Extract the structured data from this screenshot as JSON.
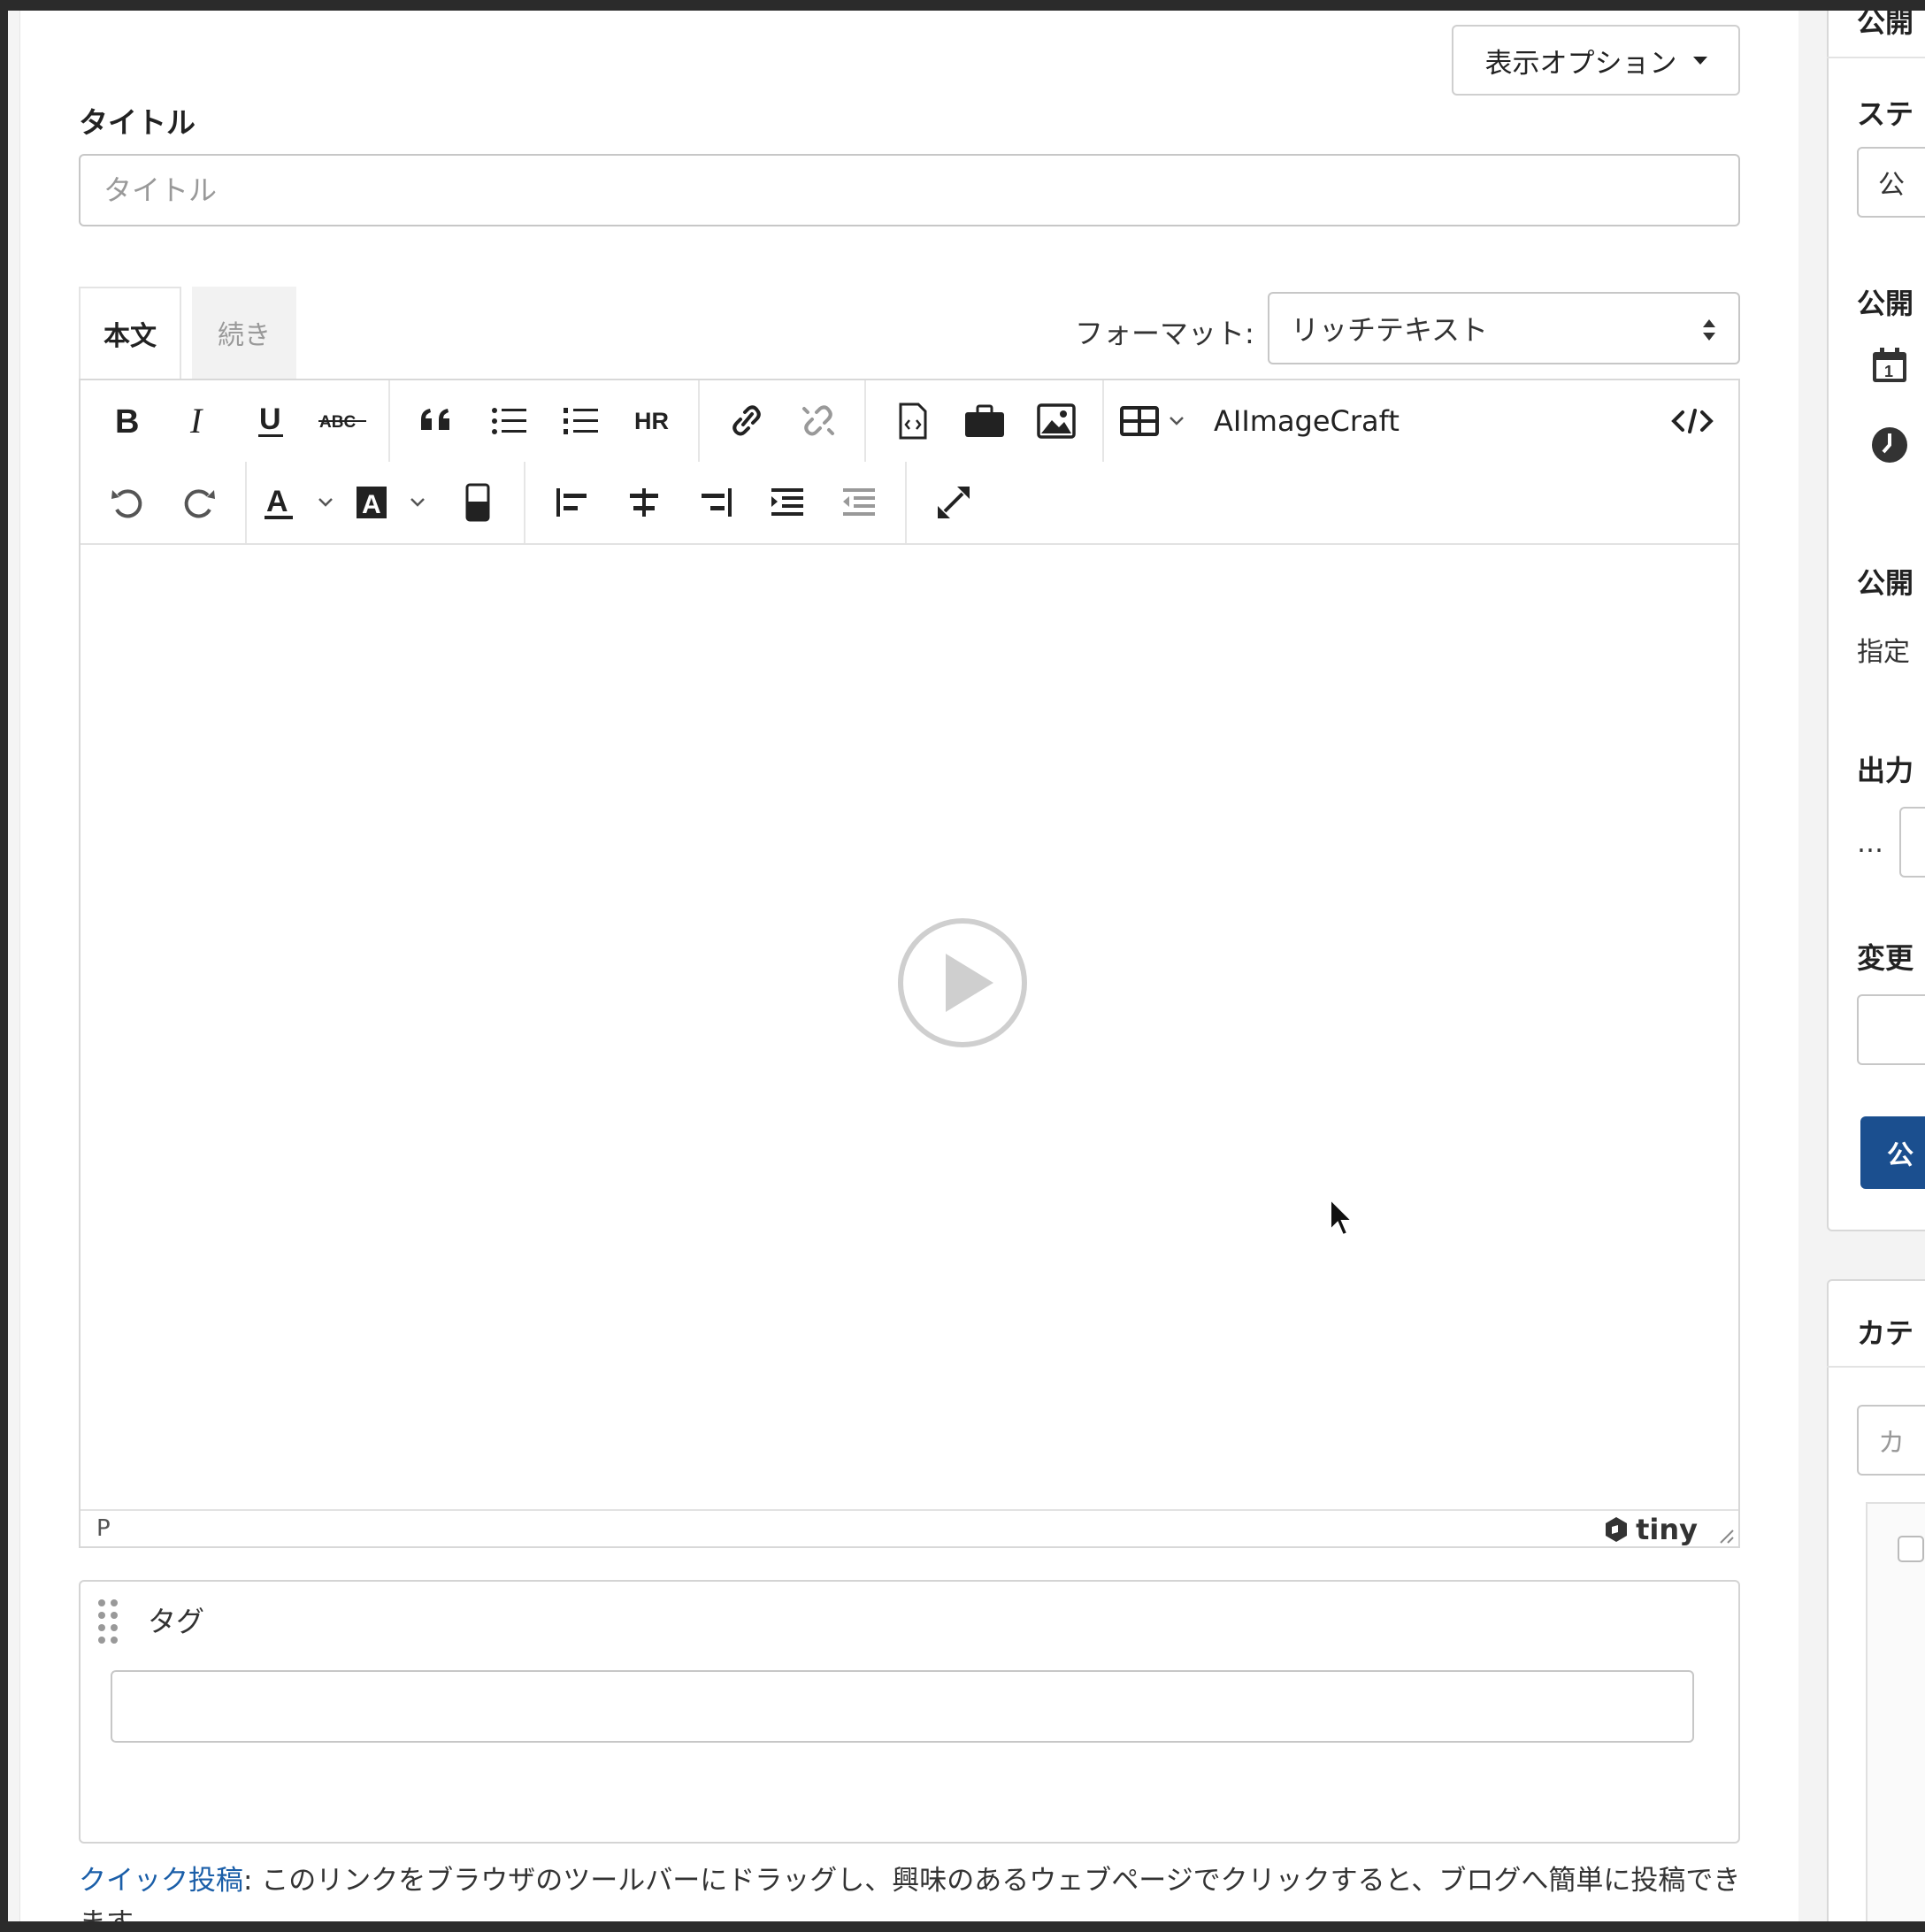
{
  "top": {
    "display_options_label": "表示オプション"
  },
  "title": {
    "label": "タイトル",
    "placeholder": "タイトル",
    "value": ""
  },
  "tabs": [
    {
      "label": "本文",
      "active": true
    },
    {
      "label": "続き",
      "active": false
    }
  ],
  "format": {
    "label": "フォーマット:",
    "value": "リッチテキスト"
  },
  "toolbar": {
    "row1": [
      "bold-icon",
      "italic-icon",
      "underline-icon",
      "strikethrough-icon",
      "blockquote-icon",
      "bullet-list-icon",
      "numbered-list-icon",
      "horizontal-rule-icon",
      "link-icon",
      "unlink-icon",
      "insert-file-icon",
      "asset-icon",
      "image-icon",
      "table-icon",
      "source-code-icon"
    ],
    "hr_label": "HR",
    "abc_label": "ABC",
    "plugin_label": "AIImageCraft",
    "row2": [
      "undo-icon",
      "redo-icon",
      "text-color-icon",
      "background-color-icon",
      "highlight-icon",
      "align-left-icon",
      "align-center-icon",
      "align-right-icon",
      "indent-icon",
      "outdent-icon",
      "fullscreen-icon"
    ]
  },
  "editor": {
    "status_path": "P",
    "brand": "tiny"
  },
  "tags": {
    "label": "タグ",
    "value": ""
  },
  "quick_post": {
    "link": "クイック投稿",
    "text": ": このリンクをブラウザのツールバーにドラッグし、興味のあるウェブページでクリックすると、ブログへ簡単に投稿できます。"
  },
  "sidebar": {
    "publish_head": "公開",
    "status_head": "ステ",
    "status_value": "公",
    "publish_date_head": "公開",
    "publish_end_head": "公開",
    "publish_end_text": "指定",
    "output_head": "出力",
    "output_text": "…",
    "change_head": "変更",
    "publish_button": "公",
    "category_head": "カテ",
    "category_placeholder": "カ"
  },
  "colors": {
    "accent": "#1b4f8f",
    "link": "#1a5ea8"
  }
}
